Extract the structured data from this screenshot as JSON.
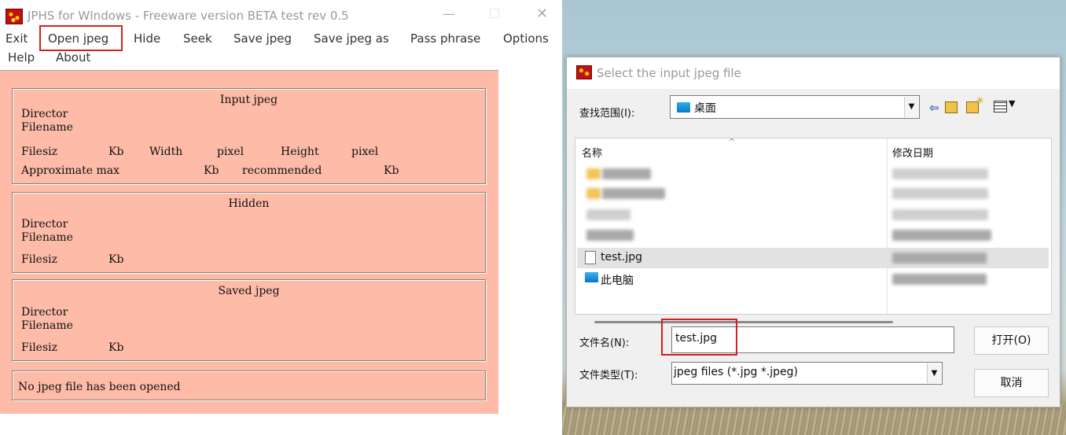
{
  "main": {
    "title": "JPHS for WIndows - Freeware version BETA test rev 0.5",
    "controls": {
      "minimize": "—",
      "close": "✕"
    },
    "menu": [
      "Exit",
      "Open jpeg",
      "Hide",
      "Seek",
      "Save jpeg",
      "Save jpeg as",
      "Pass phrase",
      "Options",
      "Help",
      "About"
    ],
    "input_group": {
      "title": "Input jpeg",
      "directory": "Director",
      "filename": "Filename",
      "filesize": "Filesiz",
      "kb": "Kb",
      "width": "Width",
      "pixel": "pixel",
      "height": "Height",
      "pixel2": "pixel",
      "approx": "Approximate max",
      "kb2": "Kb",
      "recommended": "recommended",
      "kb3": "Kb"
    },
    "hidden_group": {
      "title": "Hidden",
      "directory": "Director",
      "filename": "Filename",
      "filesize": "Filesiz",
      "kb": "Kb"
    },
    "saved_group": {
      "title": "Saved jpeg",
      "directory": "Director",
      "filename": "Filename",
      "filesize": "Filesiz",
      "kb": "Kb"
    },
    "status": "No jpeg file has been opened"
  },
  "dialog": {
    "title": "Select the input jpeg file",
    "look_in_label": "查找范围(I):",
    "look_in_value": "桌面",
    "columns": {
      "name": "名称",
      "date": "修改日期"
    },
    "files": [
      {
        "name": "test.jpg"
      },
      {
        "name": "此电脑"
      }
    ],
    "filename_label": "文件名(N):",
    "filename_value": "test.jpg",
    "filetype_label": "文件类型(T):",
    "filetype_value": "jpeg files (*.jpg *.jpeg)",
    "open_button": "打开(O)",
    "cancel_button": "取消"
  }
}
